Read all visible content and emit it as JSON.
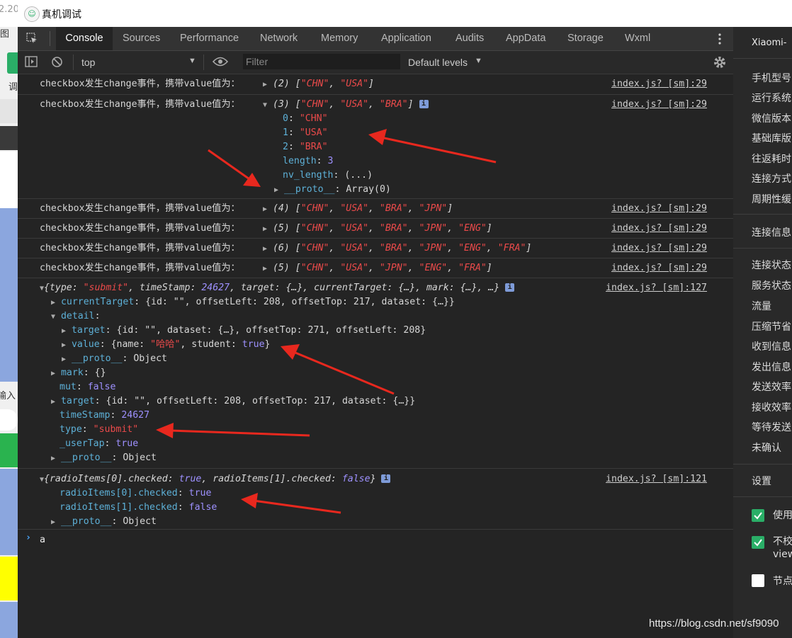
{
  "left_strip": {
    "top_text": "2.20",
    "char_tu": "图",
    "char_diao": "调",
    "char_ru": "输入"
  },
  "window": {
    "title": "真机调试"
  },
  "devtools": {
    "tabs": [
      "Console",
      "Sources",
      "Performance",
      "Network",
      "Memory",
      "Application",
      "Audits",
      "AppData",
      "Storage",
      "Wxml"
    ],
    "active_tab": "Console",
    "toolbar": {
      "context": "top",
      "filter_placeholder": "Filter",
      "levels": "Default levels"
    }
  },
  "console": {
    "messages": [
      {
        "label": "checkbox发生change事件，携带value值为：",
        "preview_count": "(2)",
        "items": [
          "\"CHN\"",
          "\"USA\""
        ],
        "source": "index.js? [sm]:29"
      },
      {
        "label": "checkbox发生change事件，携带value值为：",
        "preview_count": "(3)",
        "items": [
          "\"CHN\"",
          "\"USA\"",
          "\"BRA\""
        ],
        "source": "index.js? [sm]:29",
        "expanded": [
          {
            "key": "0",
            "value": "\"CHN\""
          },
          {
            "key": "1",
            "value": "\"USA\""
          },
          {
            "key": "2",
            "value": "\"BRA\""
          },
          {
            "key": "length",
            "value": "3"
          },
          {
            "key": "nv_length",
            "value": "(...)"
          },
          {
            "key": "__proto__",
            "value": "Array(0)"
          }
        ]
      },
      {
        "label": "checkbox发生change事件，携带value值为：",
        "preview_count": "(4)",
        "items": [
          "\"CHN\"",
          "\"USA\"",
          "\"BRA\"",
          "\"JPN\""
        ],
        "source": "index.js? [sm]:29"
      },
      {
        "label": "checkbox发生change事件，携带value值为：",
        "preview_count": "(5)",
        "items": [
          "\"CHN\"",
          "\"USA\"",
          "\"BRA\"",
          "\"JPN\"",
          "\"ENG\""
        ],
        "source": "index.js? [sm]:29"
      },
      {
        "label": "checkbox发生change事件，携带value值为：",
        "preview_count": "(6)",
        "items": [
          "\"CHN\"",
          "\"USA\"",
          "\"BRA\"",
          "\"JPN\"",
          "\"ENG\"",
          "\"FRA\""
        ],
        "source": "index.js? [sm]:29"
      },
      {
        "label": "checkbox发生change事件，携带value值为：",
        "preview_count": "(5)",
        "items": [
          "\"CHN\"",
          "\"USA\"",
          "\"JPN\"",
          "\"ENG\"",
          "\"FRA\""
        ],
        "source": "index.js? [sm]:29"
      }
    ],
    "submit_event": {
      "source": "index.js? [sm]:127",
      "summary_type": "\"submit\"",
      "summary_timestamp": "24627",
      "ct_line": "{id: \"\", offsetLeft: 208, offsetTop: 217, dataset: {…}}",
      "detail_target": "{id: \"\", dataset: {…}, offsetTop: 271, offsetLeft: 208}",
      "detail_value_name": "\"哈哈\"",
      "detail_value_student": "true",
      "target_line": "{id: \"\", offsetLeft: 208, offsetTop: 217, dataset: {…}}",
      "timeStamp": "24627",
      "type": "\"submit\"",
      "userTap": "true",
      "mut": "false"
    },
    "radio_event": {
      "source": "index.js? [sm]:121",
      "item0_checked": "true",
      "item1_checked": "false"
    },
    "prompt_input": "a"
  },
  "right_panel": {
    "device": "Xiaomi-",
    "info_items": [
      "手机型号",
      "运行系统",
      "微信版本",
      "基础库版",
      "往返耗时",
      "连接方式",
      "周期性缓"
    ],
    "section_connection": "连接信息",
    "conn_items": [
      "连接状态",
      "服务状态",
      "流量",
      "压缩节省",
      "收到信息",
      "发出信息",
      "发送效率",
      "接收效率",
      "等待发送",
      "未确认"
    ],
    "section_settings": "设置",
    "settings": [
      {
        "label": "使用",
        "checked": true
      },
      {
        "label": "不校",
        "label2": "view",
        "checked": true
      },
      {
        "label": "节点",
        "checked": false
      }
    ]
  },
  "watermark": "https://blog.csdn.net/sf9090",
  "colors": {
    "accent_green": "#2aae67",
    "arrow_red": "#e8281e",
    "string_orange": "#f28b54",
    "keyword_purple": "#9e91ff",
    "key_blue": "#5db0d7"
  }
}
